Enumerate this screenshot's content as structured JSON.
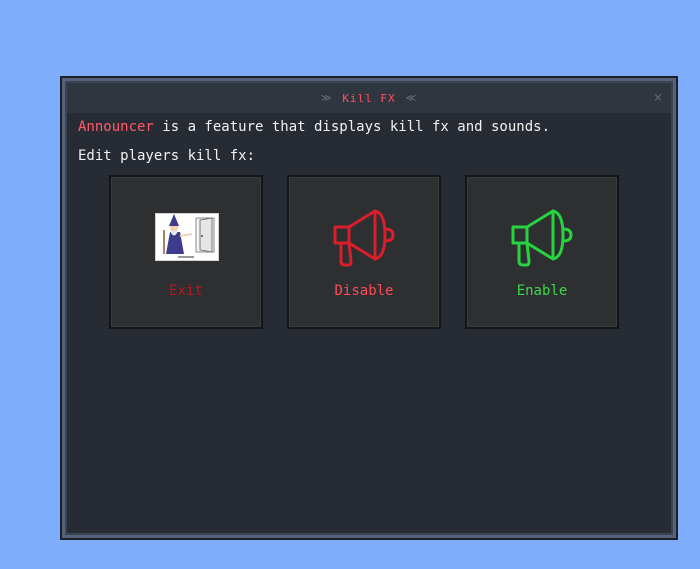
{
  "window": {
    "title": "Kill FX",
    "close_glyph": "×"
  },
  "description": {
    "highlight": "Announcer",
    "rest": " is a feature that displays kill fx and sounds."
  },
  "prompt": "Edit players kill fx:",
  "cards": [
    {
      "label": "Exit",
      "icon": "wizard-door-image",
      "color": "#b01a22"
    },
    {
      "label": "Disable",
      "icon": "megaphone-icon",
      "color": "#ff4a58"
    },
    {
      "label": "Enable",
      "icon": "megaphone-icon",
      "color": "#3ad84a"
    }
  ],
  "colors": {
    "background": "#7eadfc",
    "panel": "#272c34",
    "accent": "#ff5060"
  }
}
